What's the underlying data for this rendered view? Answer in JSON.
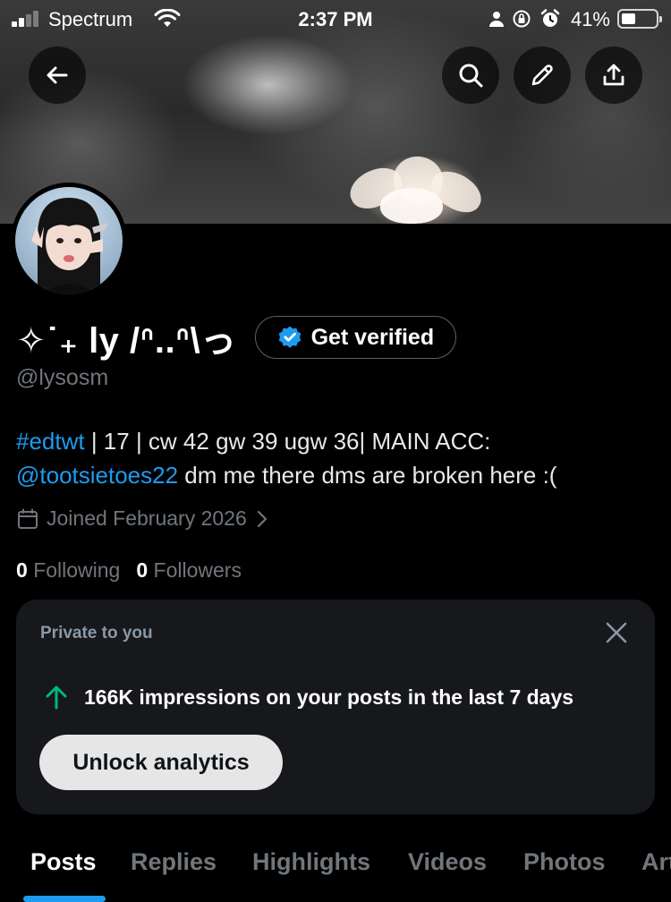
{
  "status_bar": {
    "carrier": "Spectrum",
    "time": "2:37 PM",
    "battery_percent": "41%",
    "battery_level": 0.41,
    "icons": [
      "signal-icon",
      "wifi-icon",
      "person-icon",
      "orientation-lock-icon",
      "alarm-icon",
      "battery-icon"
    ]
  },
  "header_actions": {
    "back_icon": "arrow-left-icon",
    "search_icon": "search-icon",
    "edit_icon": "pencil-icon",
    "share_icon": "share-icon"
  },
  "profile": {
    "display_name": "✧˙₊ ly /ᐢ..ᐢ\\っ",
    "get_verified_label": "Get verified",
    "verified_badge_color": "#1d9bf0",
    "handle": "@lysosm",
    "bio": {
      "hashtag": "#edtwt",
      "text1": " | 17 | cw 42 gw 39 ugw 36| MAIN ACC: ",
      "mention": "@tootsietoes22",
      "text2": " dm me there dms are broken here :("
    },
    "joined": "Joined February 2026",
    "following_count": "0",
    "following_label": "Following",
    "followers_count": "0",
    "followers_label": "Followers"
  },
  "private_card": {
    "title": "Private to you",
    "impressions_text": "166K impressions on your posts in the last 7 days",
    "trend_color": "#00ba7c",
    "unlock_label": "Unlock analytics"
  },
  "tabs": [
    {
      "label": "Posts",
      "active": true
    },
    {
      "label": "Replies",
      "active": false
    },
    {
      "label": "Highlights",
      "active": false
    },
    {
      "label": "Videos",
      "active": false
    },
    {
      "label": "Photos",
      "active": false
    },
    {
      "label": "Articles",
      "active": false
    }
  ],
  "colors": {
    "accent": "#1d9bf0",
    "background": "#000000",
    "muted_text": "#71767b"
  }
}
